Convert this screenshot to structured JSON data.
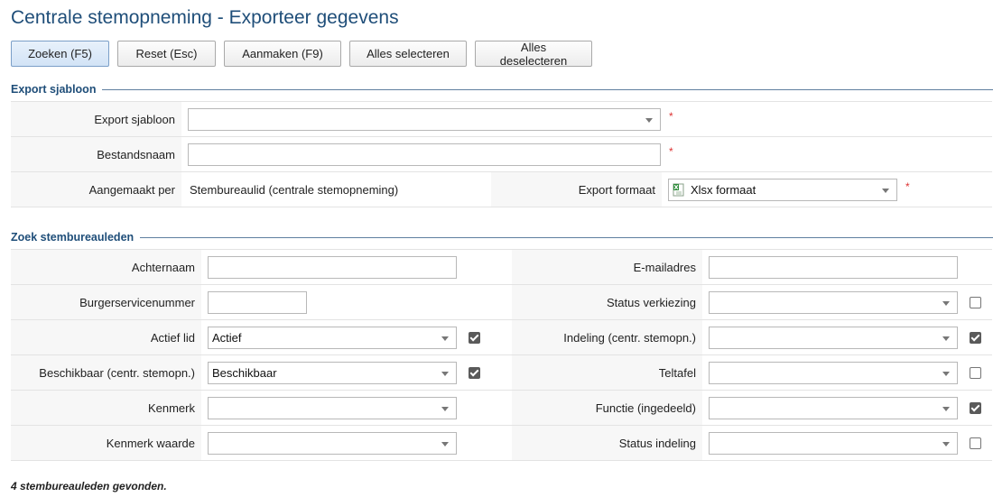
{
  "page": {
    "title": "Centrale stemopneming - Exporteer gegevens"
  },
  "toolbar": {
    "search": "Zoeken (F5)",
    "reset": "Reset (Esc)",
    "create": "Aanmaken (F9)",
    "select_all": "Alles selecteren",
    "deselect_all": "Alles deselecteren"
  },
  "export": {
    "section_title": "Export sjabloon",
    "template_label": "Export sjabloon",
    "template_value": "",
    "filename_label": "Bestandsnaam",
    "filename_value": "",
    "created_per_label": "Aangemaakt per",
    "created_per_value": "Stembureaulid (centrale stemopneming)",
    "format_label": "Export formaat",
    "format_value": "Xlsx formaat",
    "required_mark": "*"
  },
  "search": {
    "section_title": "Zoek stembureauleden",
    "surname_label": "Achternaam",
    "surname_value": "",
    "email_label": "E-mailadres",
    "email_value": "",
    "bsn_label": "Burgerservicenummer",
    "bsn_value": "",
    "election_status_label": "Status verkiezing",
    "election_status_value": "",
    "election_status_checked": false,
    "active_label": "Actief lid",
    "active_value": "Actief",
    "active_checked": true,
    "assignment_label": "Indeling (centr. stemopn.)",
    "assignment_value": "",
    "assignment_checked": true,
    "available_label": "Beschikbaar (centr. stemopn.)",
    "available_value": "Beschikbaar",
    "available_checked": true,
    "count_table_label": "Teltafel",
    "count_table_value": "",
    "count_table_checked": false,
    "attribute_label": "Kenmerk",
    "attribute_value": "",
    "function_label": "Functie (ingedeeld)",
    "function_value": "",
    "function_checked": true,
    "attribute_value_label": "Kenmerk waarde",
    "attribute_value_value": "",
    "assignment_status_label": "Status indeling",
    "assignment_status_value": "",
    "assignment_status_checked": false
  },
  "results": {
    "summary": "4 stembureauleden gevonden."
  },
  "colors": {
    "title": "#1f4e79",
    "required": "#dd3333",
    "label_bg": "#f7f7f7"
  }
}
